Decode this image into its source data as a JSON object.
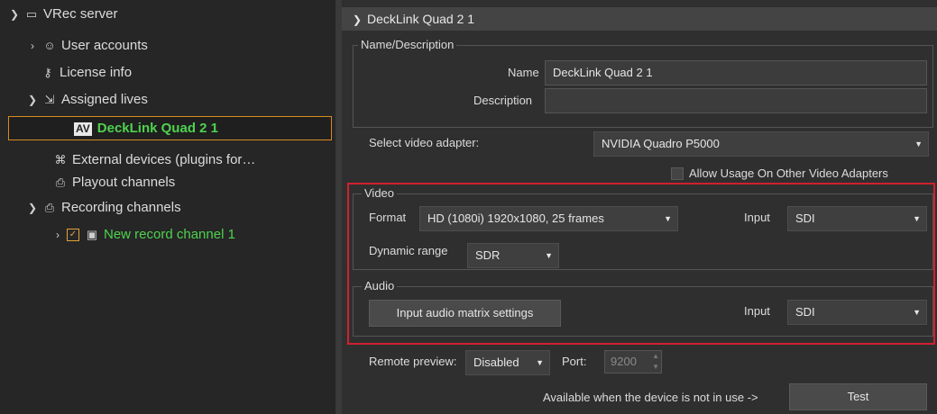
{
  "tree": {
    "server": "VRec server",
    "user_accounts": "User accounts",
    "license_info": "License info",
    "assigned_lives": "Assigned lives",
    "av_badge": "AV",
    "decklink": "DeckLink Quad 2 1",
    "external_devices": "External devices (plugins for…",
    "playout_channels": "Playout channels",
    "recording_channels": "Recording channels",
    "new_record_channel": "New record channel 1"
  },
  "panel": {
    "title": "DeckLink Quad 2 1",
    "name_desc_group": "Name/Description",
    "name_label": "Name",
    "name_value": "DeckLink Quad 2 1",
    "description_label": "Description",
    "description_value": "",
    "adapter_label": "Select video adapter:",
    "adapter_value": "NVIDIA Quadro P5000",
    "allow_usage_label": "Allow Usage On Other Video Adapters",
    "video_group": "Video",
    "format_label": "Format",
    "format_value": "HD (1080i) 1920x1080, 25 frames",
    "video_input_label": "Input",
    "video_input_value": "SDI",
    "dynamic_range_label": "Dynamic range",
    "dynamic_range_value": "SDR",
    "audio_group": "Audio",
    "audio_matrix_button": "Input audio matrix settings",
    "audio_input_label": "Input",
    "audio_input_value": "SDI",
    "remote_preview_label": "Remote preview:",
    "remote_preview_value": "Disabled",
    "port_label": "Port:",
    "port_value": "9200",
    "available_note": "Available when the device is not in use ->",
    "test_button": "Test"
  },
  "colors": {
    "accent_green": "#4ed24e",
    "selection_border": "#d58b22",
    "highlight_red": "#d02030"
  }
}
